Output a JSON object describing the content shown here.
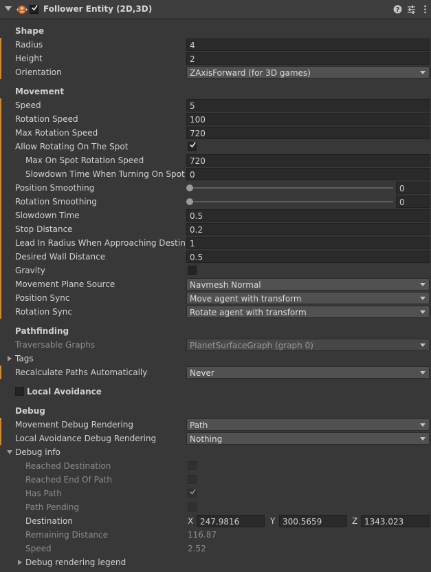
{
  "header": {
    "title": "Follower Entity (2D,3D)",
    "help_icon": "help-icon",
    "preset_icon": "preset-sliders-icon",
    "menu_icon": "kebab-menu-icon",
    "enabled": true
  },
  "shape": {
    "section": "Shape",
    "radius_label": "Radius",
    "radius_value": "4",
    "height_label": "Height",
    "height_value": "2",
    "orientation_label": "Orientation",
    "orientation_value": "ZAxisForward (for 3D games)"
  },
  "movement": {
    "section": "Movement",
    "speed_label": "Speed",
    "speed_value": "5",
    "rotation_speed_label": "Rotation Speed",
    "rotation_speed_value": "100",
    "max_rotation_speed_label": "Max Rotation Speed",
    "max_rotation_speed_value": "720",
    "allow_rotating_label": "Allow Rotating On The Spot",
    "allow_rotating_checked": true,
    "max_on_spot_label": "Max On Spot Rotation Speed",
    "max_on_spot_value": "720",
    "slowdown_turning_label": "Slowdown Time When Turning On Spot",
    "slowdown_turning_value": "0",
    "position_smoothing_label": "Position Smoothing",
    "position_smoothing_value": "0",
    "rotation_smoothing_label": "Rotation Smoothing",
    "rotation_smoothing_value": "0",
    "slowdown_time_label": "Slowdown Time",
    "slowdown_time_value": "0.5",
    "stop_distance_label": "Stop Distance",
    "stop_distance_value": "0.2",
    "lead_in_label": "Lead In Radius When Approaching Destinat",
    "lead_in_value": "1",
    "wall_distance_label": "Desired Wall Distance",
    "wall_distance_value": "0.5",
    "gravity_label": "Gravity",
    "gravity_checked": false,
    "plane_source_label": "Movement Plane Source",
    "plane_source_value": "Navmesh Normal",
    "position_sync_label": "Position Sync",
    "position_sync_value": "Move agent with transform",
    "rotation_sync_label": "Rotation Sync",
    "rotation_sync_value": "Rotate agent with transform"
  },
  "pathfinding": {
    "section": "Pathfinding",
    "graphs_label": "Traversable Graphs",
    "graphs_value": "PlanetSurfaceGraph (graph 0)",
    "tags_label": "Tags",
    "recalc_label": "Recalculate Paths Automatically",
    "recalc_value": "Never"
  },
  "local_avoidance": {
    "label": "Local Avoidance",
    "checked": false
  },
  "debug": {
    "section": "Debug",
    "movement_rendering_label": "Movement Debug Rendering",
    "movement_rendering_value": "Path",
    "avoidance_rendering_label": "Local Avoidance Debug Rendering",
    "avoidance_rendering_value": "Nothing",
    "info_label": "Debug info",
    "reached_destination_label": "Reached Destination",
    "reached_destination_checked": false,
    "reached_end_label": "Reached End Of Path",
    "reached_end_checked": false,
    "has_path_label": "Has Path",
    "has_path_checked": true,
    "path_pending_label": "Path Pending",
    "path_pending_checked": false,
    "destination_label": "Destination",
    "dest_x_label": "X",
    "dest_x": "247.9816",
    "dest_y_label": "Y",
    "dest_y": "300.5659",
    "dest_z_label": "Z",
    "dest_z": "1343.023",
    "remaining_label": "Remaining Distance",
    "remaining_value": "116.87",
    "speed_label": "Speed",
    "speed_value": "2.52",
    "legend_label": "Debug rendering legend"
  },
  "colors": {
    "modified_bar": "#cd8b3a",
    "background": "#383838",
    "field": "#2a2a2a"
  }
}
